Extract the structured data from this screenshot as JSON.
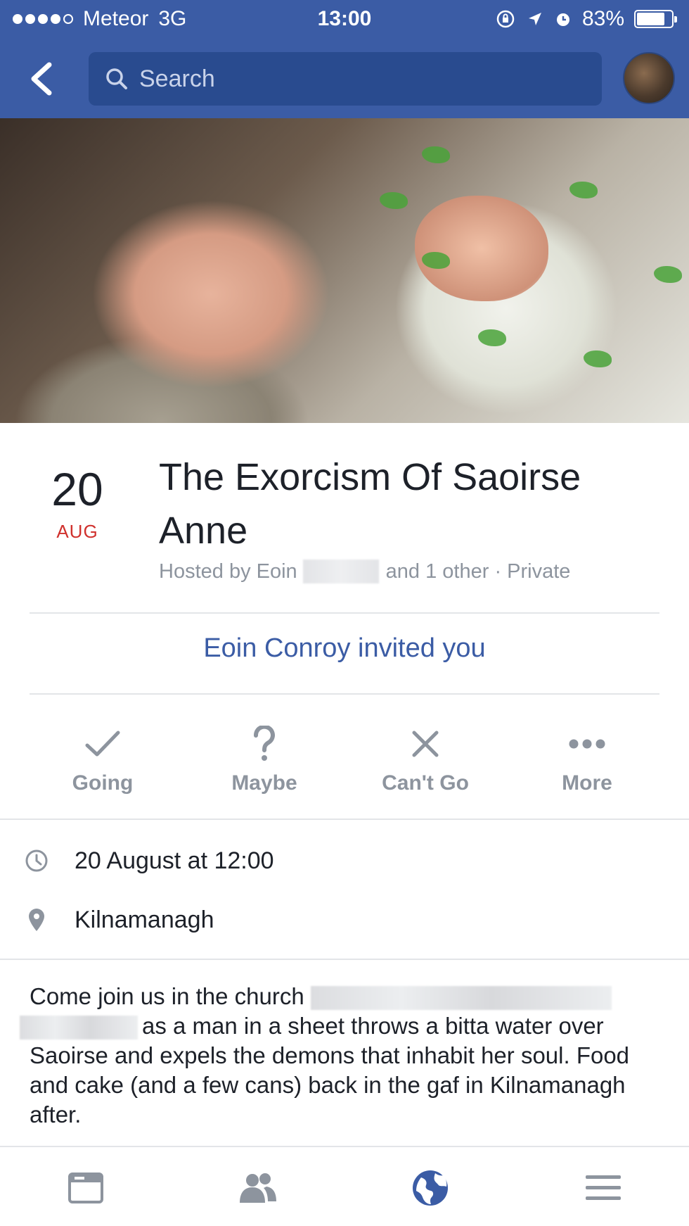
{
  "status_bar": {
    "carrier": "Meteor",
    "network": "3G",
    "time": "13:00",
    "battery": "83%",
    "battery_level": 0.83
  },
  "nav": {
    "search_placeholder": "Search"
  },
  "event": {
    "date_day": "20",
    "date_month": "AUG",
    "title": "The Exorcism Of Saoirse Anne",
    "host_prefix": "Hosted by Eoin",
    "host_suffix": "and 1 other · Private",
    "invited_text": "Eoin Conroy invited you"
  },
  "rsvp": {
    "going": "Going",
    "maybe": "Maybe",
    "cant_go": "Can't Go",
    "more": "More"
  },
  "details": {
    "datetime": "20 August at 12:00",
    "location": "Kilnamanagh"
  },
  "description": {
    "part1": "Come join us in the church",
    "part2": "as a man in a sheet throws a bitta water over Saoirse and expels the demons that inhabit her soul. Food and cake (and a few cans) back in the gaf in Kilnamanagh after."
  },
  "colors": {
    "brand_blue": "#3b5ca5",
    "date_red": "#d0312d",
    "muted_gray": "#8d949e"
  },
  "icons": {
    "going": "checkmark-icon",
    "maybe": "question-icon",
    "cant_go": "x-icon",
    "more": "ellipsis-icon",
    "time": "clock-icon",
    "location": "pin-icon",
    "tabs": [
      "news-feed-icon",
      "friends-icon",
      "globe-icon",
      "menu-icon"
    ]
  }
}
